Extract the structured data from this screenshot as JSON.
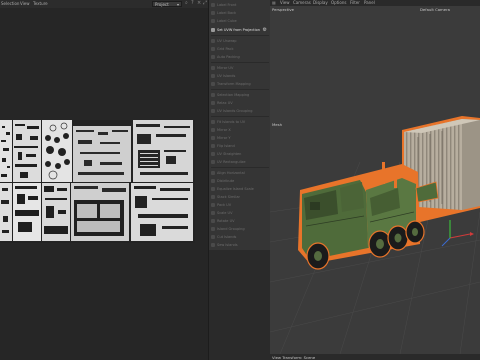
{
  "uv_editor": {
    "menu": [
      "Selection",
      "View",
      "Texture"
    ],
    "mode_select": "Project",
    "toolbar_icons": [
      "zoom-icon",
      "help-icon",
      "close-icon",
      "expand-icon"
    ]
  },
  "tools": {
    "items": [
      {
        "label": "Label Front",
        "active": false
      },
      {
        "label": "Label Back",
        "active": false
      },
      {
        "label": "Label Cube",
        "active": false
      },
      {
        "label": "Set UVW from Projection",
        "active": true
      },
      {
        "label": "UV Unwrap",
        "active": false
      },
      {
        "label": "Grid Pack",
        "active": false
      },
      {
        "label": "Auto Packing",
        "active": false
      },
      {
        "label": "Mirror UV",
        "active": false
      },
      {
        "label": "UV Islands",
        "active": false
      },
      {
        "label": "Transform Mapping",
        "active": false
      },
      {
        "label": "Selection Mapping",
        "active": false
      },
      {
        "label": "Relax UV",
        "active": false
      },
      {
        "label": "UV Islands Grouping",
        "active": false
      },
      {
        "label": "Fit Islands to UV",
        "active": false
      },
      {
        "label": "Mirror X",
        "active": false
      },
      {
        "label": "Mirror Y",
        "active": false
      },
      {
        "label": "Flip Island",
        "active": false
      },
      {
        "label": "UV Straighten",
        "active": false
      },
      {
        "label": "UV Rectangulize",
        "active": false
      },
      {
        "label": "Align Horizontal",
        "active": false
      },
      {
        "label": "Distribute",
        "active": false
      },
      {
        "label": "Equalize Island Scale",
        "active": false
      },
      {
        "label": "Stack Similar",
        "active": false
      },
      {
        "label": "Pack UV",
        "active": false
      },
      {
        "label": "Scale UV",
        "active": false
      },
      {
        "label": "Rotate UV",
        "active": false
      },
      {
        "label": "Island Grouping",
        "active": false
      },
      {
        "label": "Cut Islands",
        "active": false
      },
      {
        "label": "Sew Islands",
        "active": false
      },
      {
        "label": "Weld Points",
        "active": false
      },
      {
        "label": "Selection",
        "active": false
      },
      {
        "label": "Settings",
        "active": false
      }
    ]
  },
  "viewport": {
    "menu": [
      "View",
      "Cameras",
      "Display",
      "Options",
      "Filter",
      "Panel"
    ],
    "name": "Perspective",
    "camera": "Default Camera",
    "object_label": "Mesh",
    "footer": "View Transform: Scene"
  },
  "colors": {
    "truck_body": "#4f6b3a",
    "selection_outline": "#e8742a",
    "container": "#b7ae9f"
  }
}
